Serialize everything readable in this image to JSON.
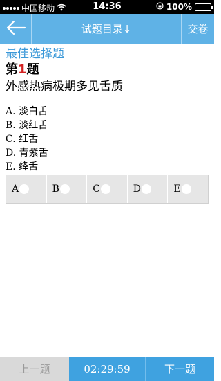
{
  "status_bar": {
    "carrier": "中国移动",
    "time": "14:36",
    "battery": "100%",
    "signal_icon": "signal-dots-icon",
    "wifi_icon": "wifi-icon",
    "lock_icon": "orientation-lock-icon",
    "battery_icon": "battery-icon"
  },
  "nav": {
    "back_icon": "back-arrow-icon",
    "title": "试题目录↓",
    "submit": "交卷"
  },
  "question": {
    "section": "最佳选择题",
    "number_prefix": "第",
    "number": "1",
    "number_suffix": "题",
    "text": "外感热病极期多见舌质",
    "options": [
      "A. 淡白舌",
      "B. 淡红舌",
      "C. 红舌",
      "D. 青紫舌",
      "E. 绛舌"
    ]
  },
  "answers": [
    "A",
    "B",
    "C",
    "D",
    "E"
  ],
  "bottom": {
    "prev": "上一题",
    "timer": "02:29:59",
    "next": "下一题"
  },
  "colors": {
    "nav_bg": "#5fb2e6",
    "accent": "#3a98d8",
    "bottom_blue": "#3fa2e0",
    "qnum_red": "#d32020"
  }
}
